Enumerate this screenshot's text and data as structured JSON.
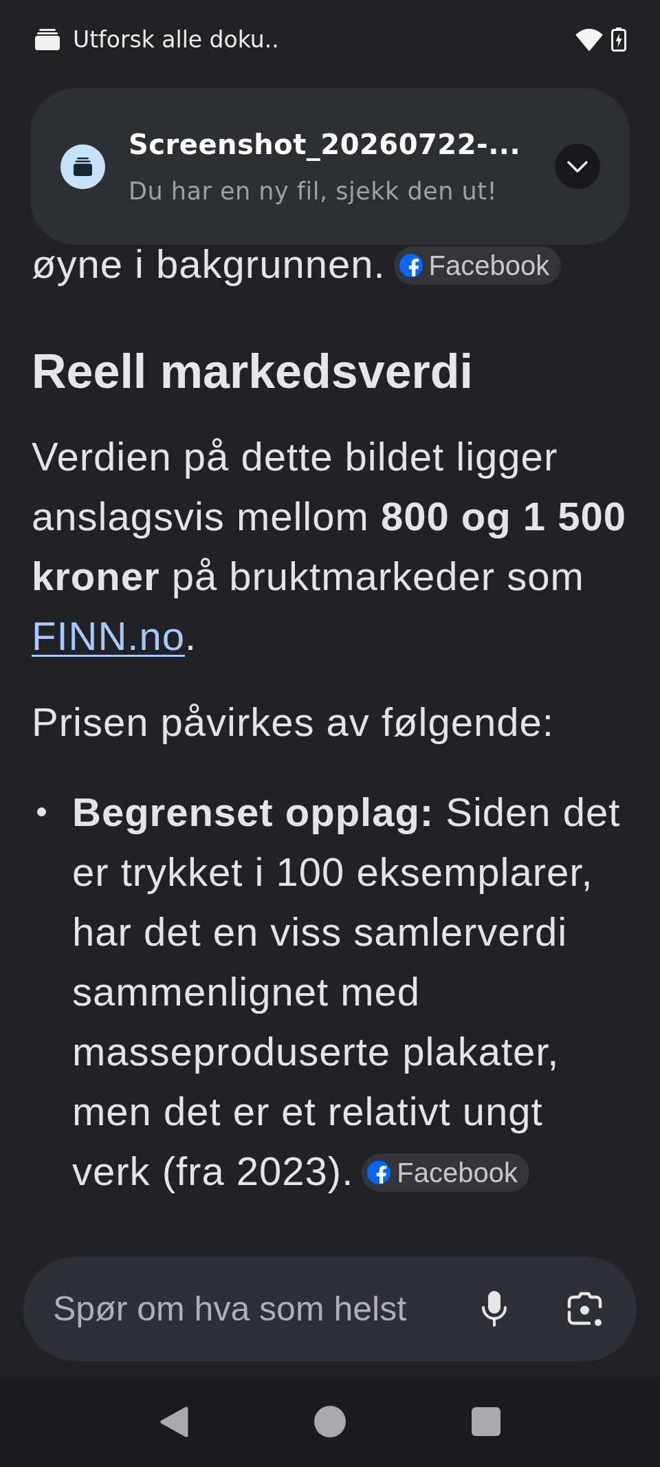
{
  "status_bar": {
    "text": "Utforsk alle doku.."
  },
  "notification": {
    "title": "Screenshot_20260722-...",
    "message": "Du har en ny fil, sjekk den ut!"
  },
  "content": [
    {
      "kind": "text",
      "text": "øyne i bakgrunnen.",
      "source": "Facebook"
    },
    {
      "kind": "heading",
      "text": "Reell markedsverdi"
    },
    {
      "kind": "text",
      "text": "Verdien på dette bildet ligger anslagsvis mellom **800 og 1 500 kroner** på bruktmarkeder som",
      "link": "FINN.no",
      "trailing": "."
    },
    {
      "kind": "text",
      "text": "Prisen påvirkes av følgende:"
    },
    {
      "kind": "bullet",
      "text": "**Begrenset opplag:** Siden det er trykket i 100 eksemplarer, har det en viss samlerverdi sammenlignet med masseproduserte plakater, men det er et relativt ungt verk (fra 2023).",
      "source": "Facebook"
    }
  ],
  "prompt_bar": {
    "placeholder": "Spør om hva som helst"
  }
}
